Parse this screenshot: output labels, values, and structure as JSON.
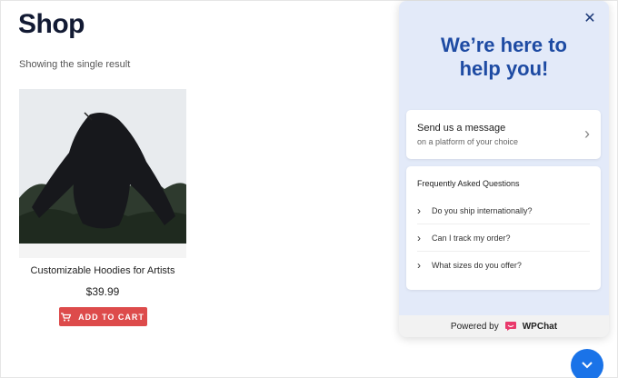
{
  "shop": {
    "title": "Shop",
    "result_count": "Showing the single result"
  },
  "product": {
    "name": "Customizable Hoodies for Artists",
    "price": "$39.99",
    "add_to_cart_label": "ADD TO CART",
    "image_icon": "hoodie-photo"
  },
  "chat": {
    "close_icon": "close-icon",
    "heading_line1": "We’re here to",
    "heading_line2": "help you!",
    "message_card": {
      "title": "Send us a message",
      "subtitle": "on a platform of your choice"
    },
    "faq": {
      "title": "Frequently Asked Questions",
      "items": [
        {
          "label": "Do you ship internationally?"
        },
        {
          "label": "Can I track my order?"
        },
        {
          "label": "What sizes do you offer?"
        }
      ]
    },
    "powered_by": "Powered by",
    "brand": "WPChat"
  },
  "colors": {
    "accent": "#1e4ba3",
    "cart_button": "#dd4b4b",
    "launcher": "#1a73e8",
    "widget_bg": "#e3eaf9"
  }
}
